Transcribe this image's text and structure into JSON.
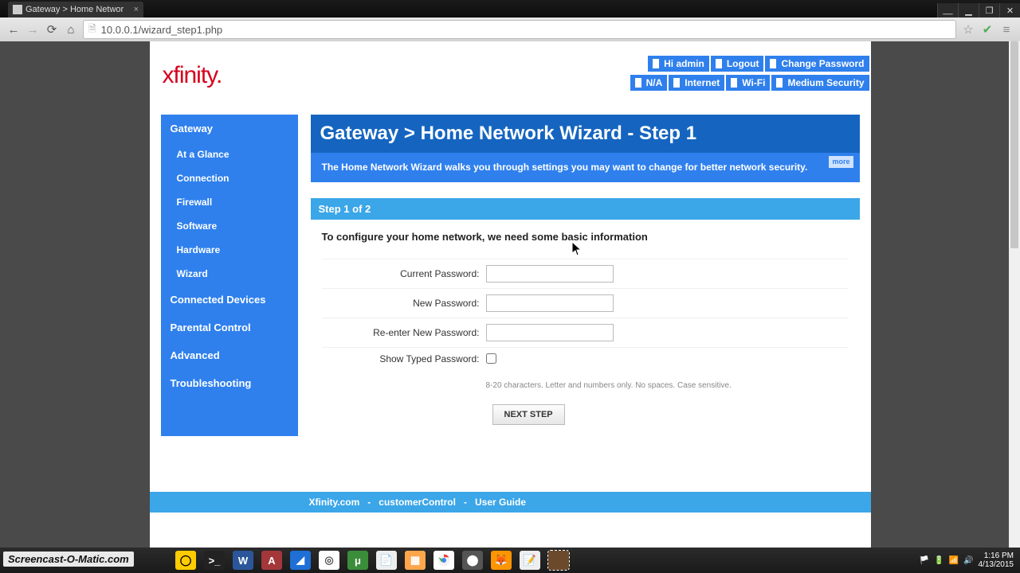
{
  "browser": {
    "tab_title": "Gateway > Home Networ",
    "url": "10.0.0.1/wizard_step1.php"
  },
  "header": {
    "logo_text": "xfinity",
    "row1": {
      "greeting": "Hi admin",
      "logout": "Logout",
      "change_pw": "Change Password"
    },
    "row2": {
      "na": "N/A",
      "internet": "Internet",
      "wifi": "Wi-Fi",
      "security": "Medium Security"
    }
  },
  "sidebar": {
    "gateway": "Gateway",
    "sub": {
      "glance": "At a Glance",
      "connection": "Connection",
      "firewall": "Firewall",
      "software": "Software",
      "hardware": "Hardware",
      "wizard": "Wizard"
    },
    "connected": "Connected Devices",
    "parental": "Parental Control",
    "advanced": "Advanced",
    "trouble": "Troubleshooting"
  },
  "main": {
    "title": "Gateway > Home Network Wizard - Step 1",
    "msg": "The Home Network Wizard walks you through settings you may want to change for better network security.",
    "more": "more",
    "step": "Step 1 of 2",
    "instr": "To configure your home network, we need some basic information",
    "labels": {
      "current": "Current Password:",
      "newpw": "New Password:",
      "renew": "Re-enter New Password:",
      "show": "Show Typed Password:"
    },
    "hint": "8-20 characters. Letter and numbers only. No spaces. Case sensitive.",
    "next": "NEXT STEP"
  },
  "footer": {
    "a": "Xfinity.com",
    "sep": "-",
    "b": "customerControl",
    "c": "User Guide"
  },
  "taskbar": {
    "watermark": "Screencast-O-Matic.com",
    "time": "1:16 PM",
    "date": "4/13/2015"
  }
}
